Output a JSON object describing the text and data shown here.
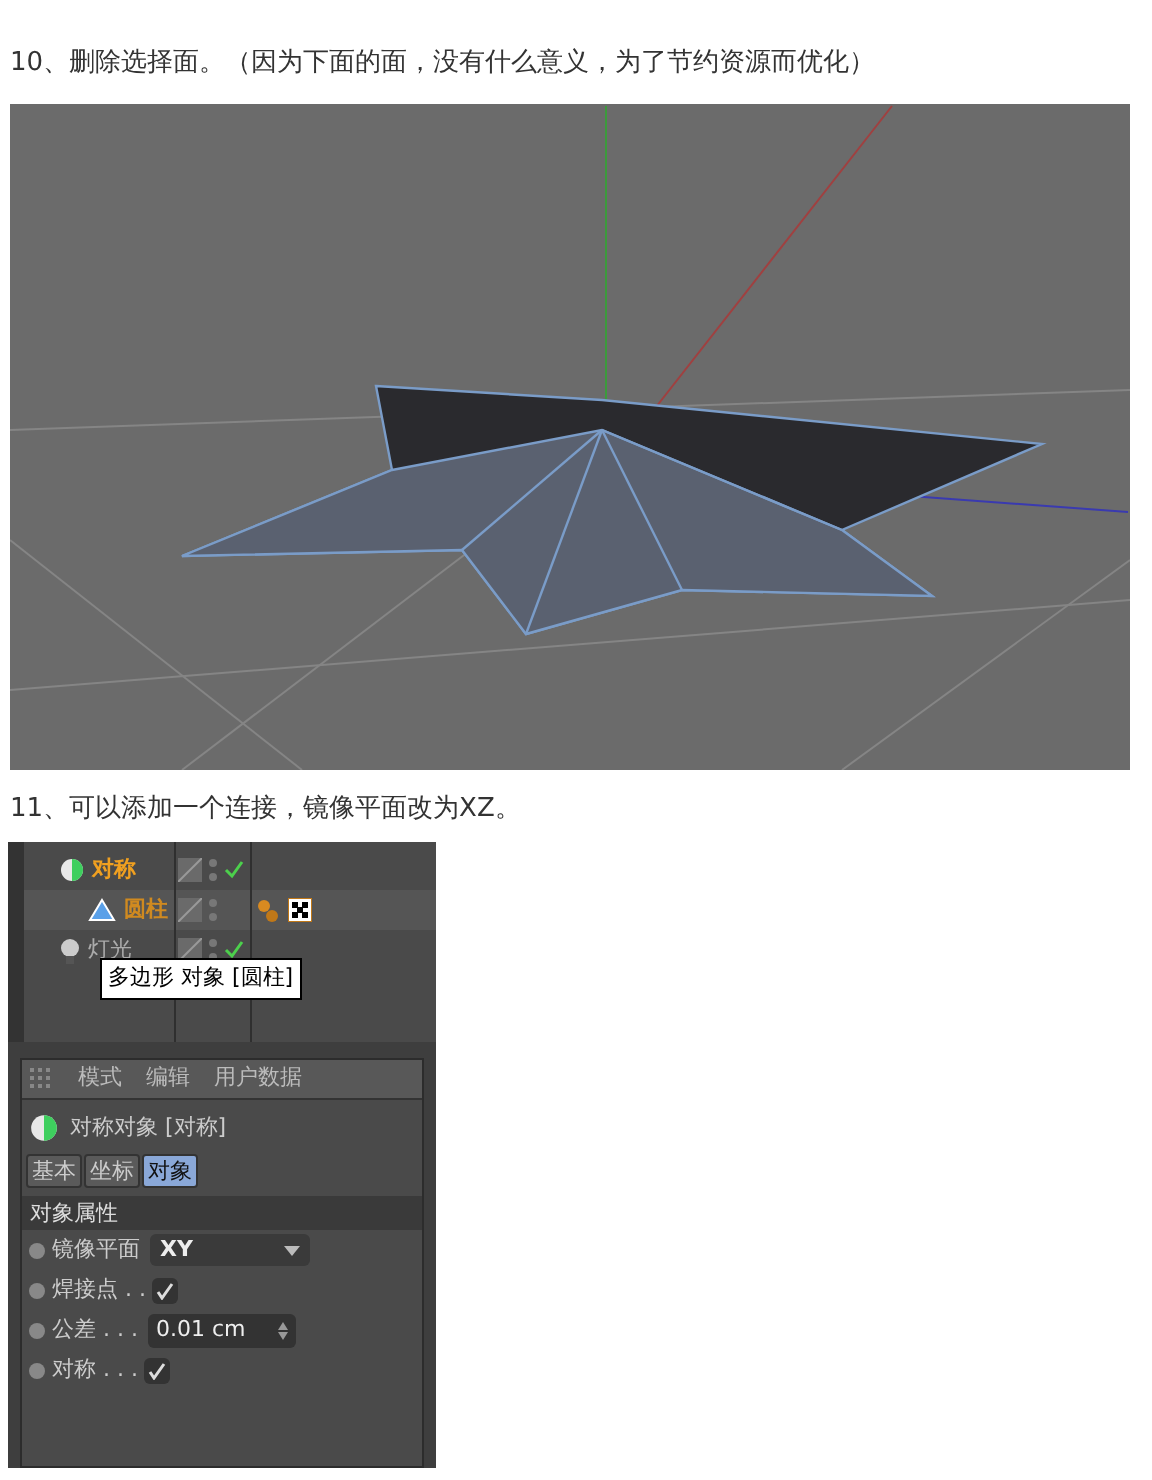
{
  "step_10": {
    "text": "10、删除选择面。（因为下面的面，没有什么意义，为了节约资源而优化）"
  },
  "step_11": {
    "text": "11、可以添加一个连接，镜像平面改为XZ。"
  },
  "object_manager": {
    "objects": [
      {
        "name": "对称",
        "kind": "symmetry",
        "selected": true,
        "checked": true,
        "tags": false,
        "children": [
          {
            "name": "圆柱",
            "kind": "polygon",
            "selected": true,
            "checked": false,
            "tags": true
          }
        ]
      },
      {
        "name": "灯光",
        "kind": "light",
        "selected": false,
        "checked": true,
        "tags": false
      }
    ],
    "tooltip": "多边形 对象 [圆柱]"
  },
  "attribute_manager": {
    "menu": [
      "模式",
      "编辑",
      "用户数据"
    ],
    "title": "对称对象 [对称]",
    "tabs": [
      {
        "label": "基本",
        "selected": false
      },
      {
        "label": "坐标",
        "selected": false
      },
      {
        "label": "对象",
        "selected": true
      }
    ],
    "section": "对象属性",
    "fields": [
      {
        "kind": "dropdown",
        "label": "镜像平面",
        "value": "XY"
      },
      {
        "kind": "checkbox",
        "label": "焊接点 . .",
        "checked": true
      },
      {
        "kind": "number",
        "label": "公差 . . .",
        "value": "0.01 cm"
      },
      {
        "kind": "checkbox",
        "label": "对称 . . .",
        "checked": true
      }
    ]
  }
}
